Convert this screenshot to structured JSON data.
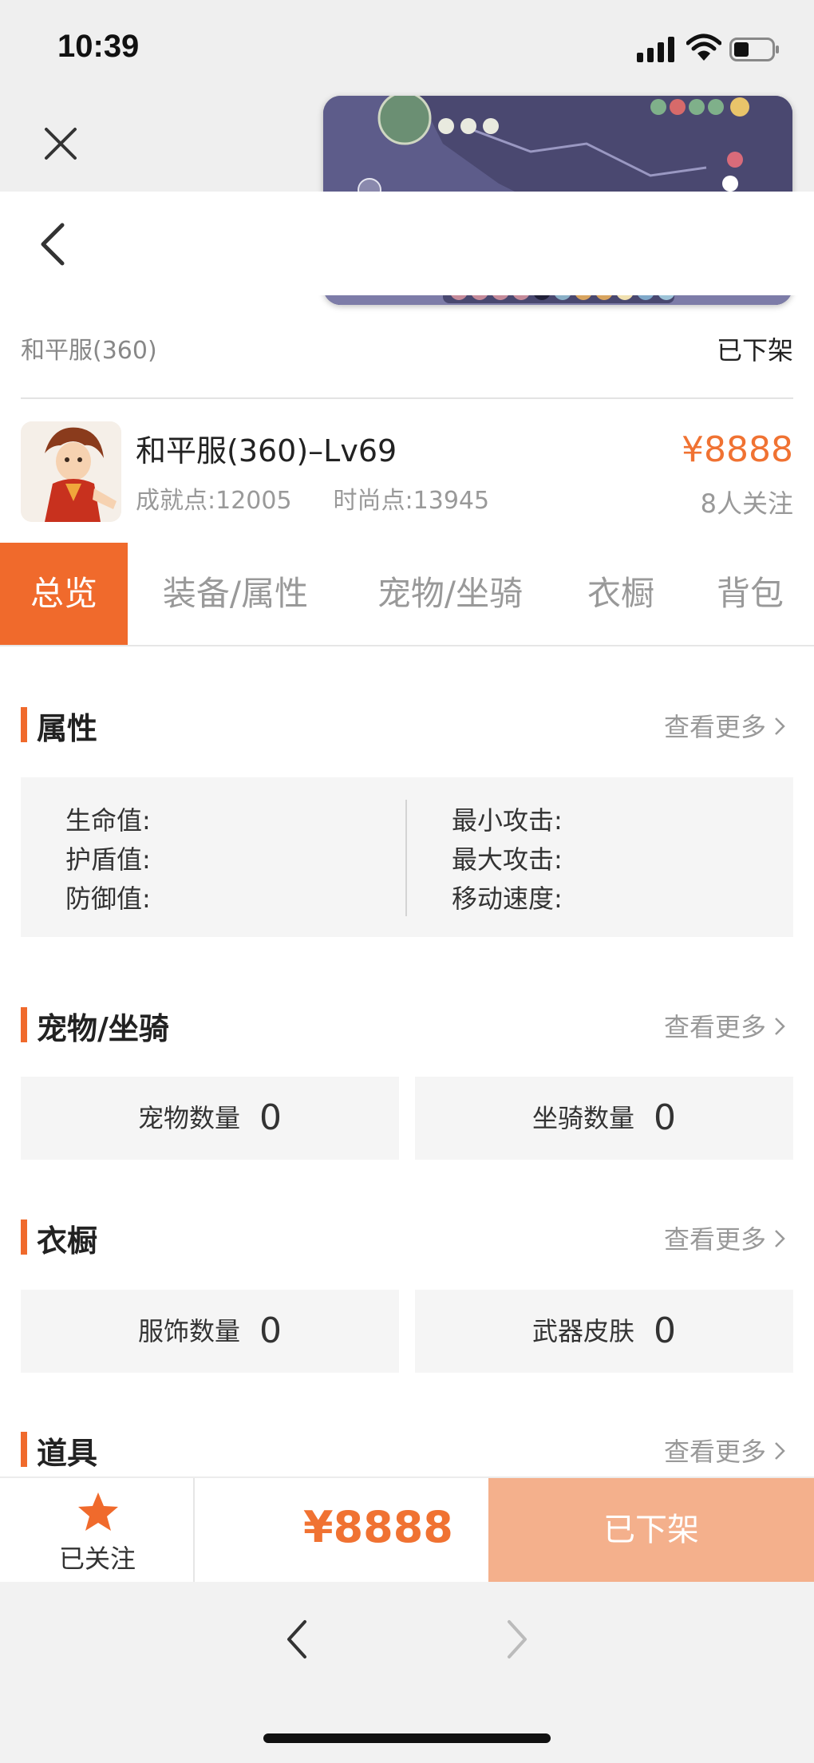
{
  "status_bar": {
    "time": "10:39"
  },
  "server": {
    "name": "和平服(360)",
    "status": "已下架"
  },
  "product": {
    "title": "和平服(360)–Lv69",
    "achievement": "成就点:12005",
    "fashion": "时尚点:13945",
    "price": "¥8888",
    "followers": "8人关注"
  },
  "tabs": [
    "总览",
    "装备/属性",
    "宠物/坐骑",
    "衣橱",
    "背包"
  ],
  "active_tab": "总览",
  "sections": {
    "attributes": {
      "title": "属性",
      "more": "查看更多",
      "left": [
        "生命值:",
        "护盾值:",
        "防御值:"
      ],
      "right": [
        "最小攻击:",
        "最大攻击:",
        "移动速度:"
      ]
    },
    "pets": {
      "title": "宠物/坐骑",
      "more": "查看更多",
      "pet_label": "宠物数量",
      "pet_count": "0",
      "mount_label": "坐骑数量",
      "mount_count": "0"
    },
    "wardrobe": {
      "title": "衣橱",
      "more": "查看更多",
      "outfit_label": "服饰数量",
      "outfit_count": "0",
      "skin_label": "武器皮肤",
      "skin_count": "0"
    },
    "items": {
      "title": "道具",
      "more": "查看更多"
    }
  },
  "footer": {
    "follow_label": "已关注",
    "price": "¥8888",
    "action": "已下架"
  },
  "colors": {
    "accent": "#f06a2c",
    "price": "#f07232",
    "disabled_button": "#f4b08c"
  },
  "icons": [
    "close-icon",
    "back-icon",
    "chevron-right-icon",
    "star-icon",
    "signal-icon",
    "wifi-icon",
    "battery-icon"
  ]
}
